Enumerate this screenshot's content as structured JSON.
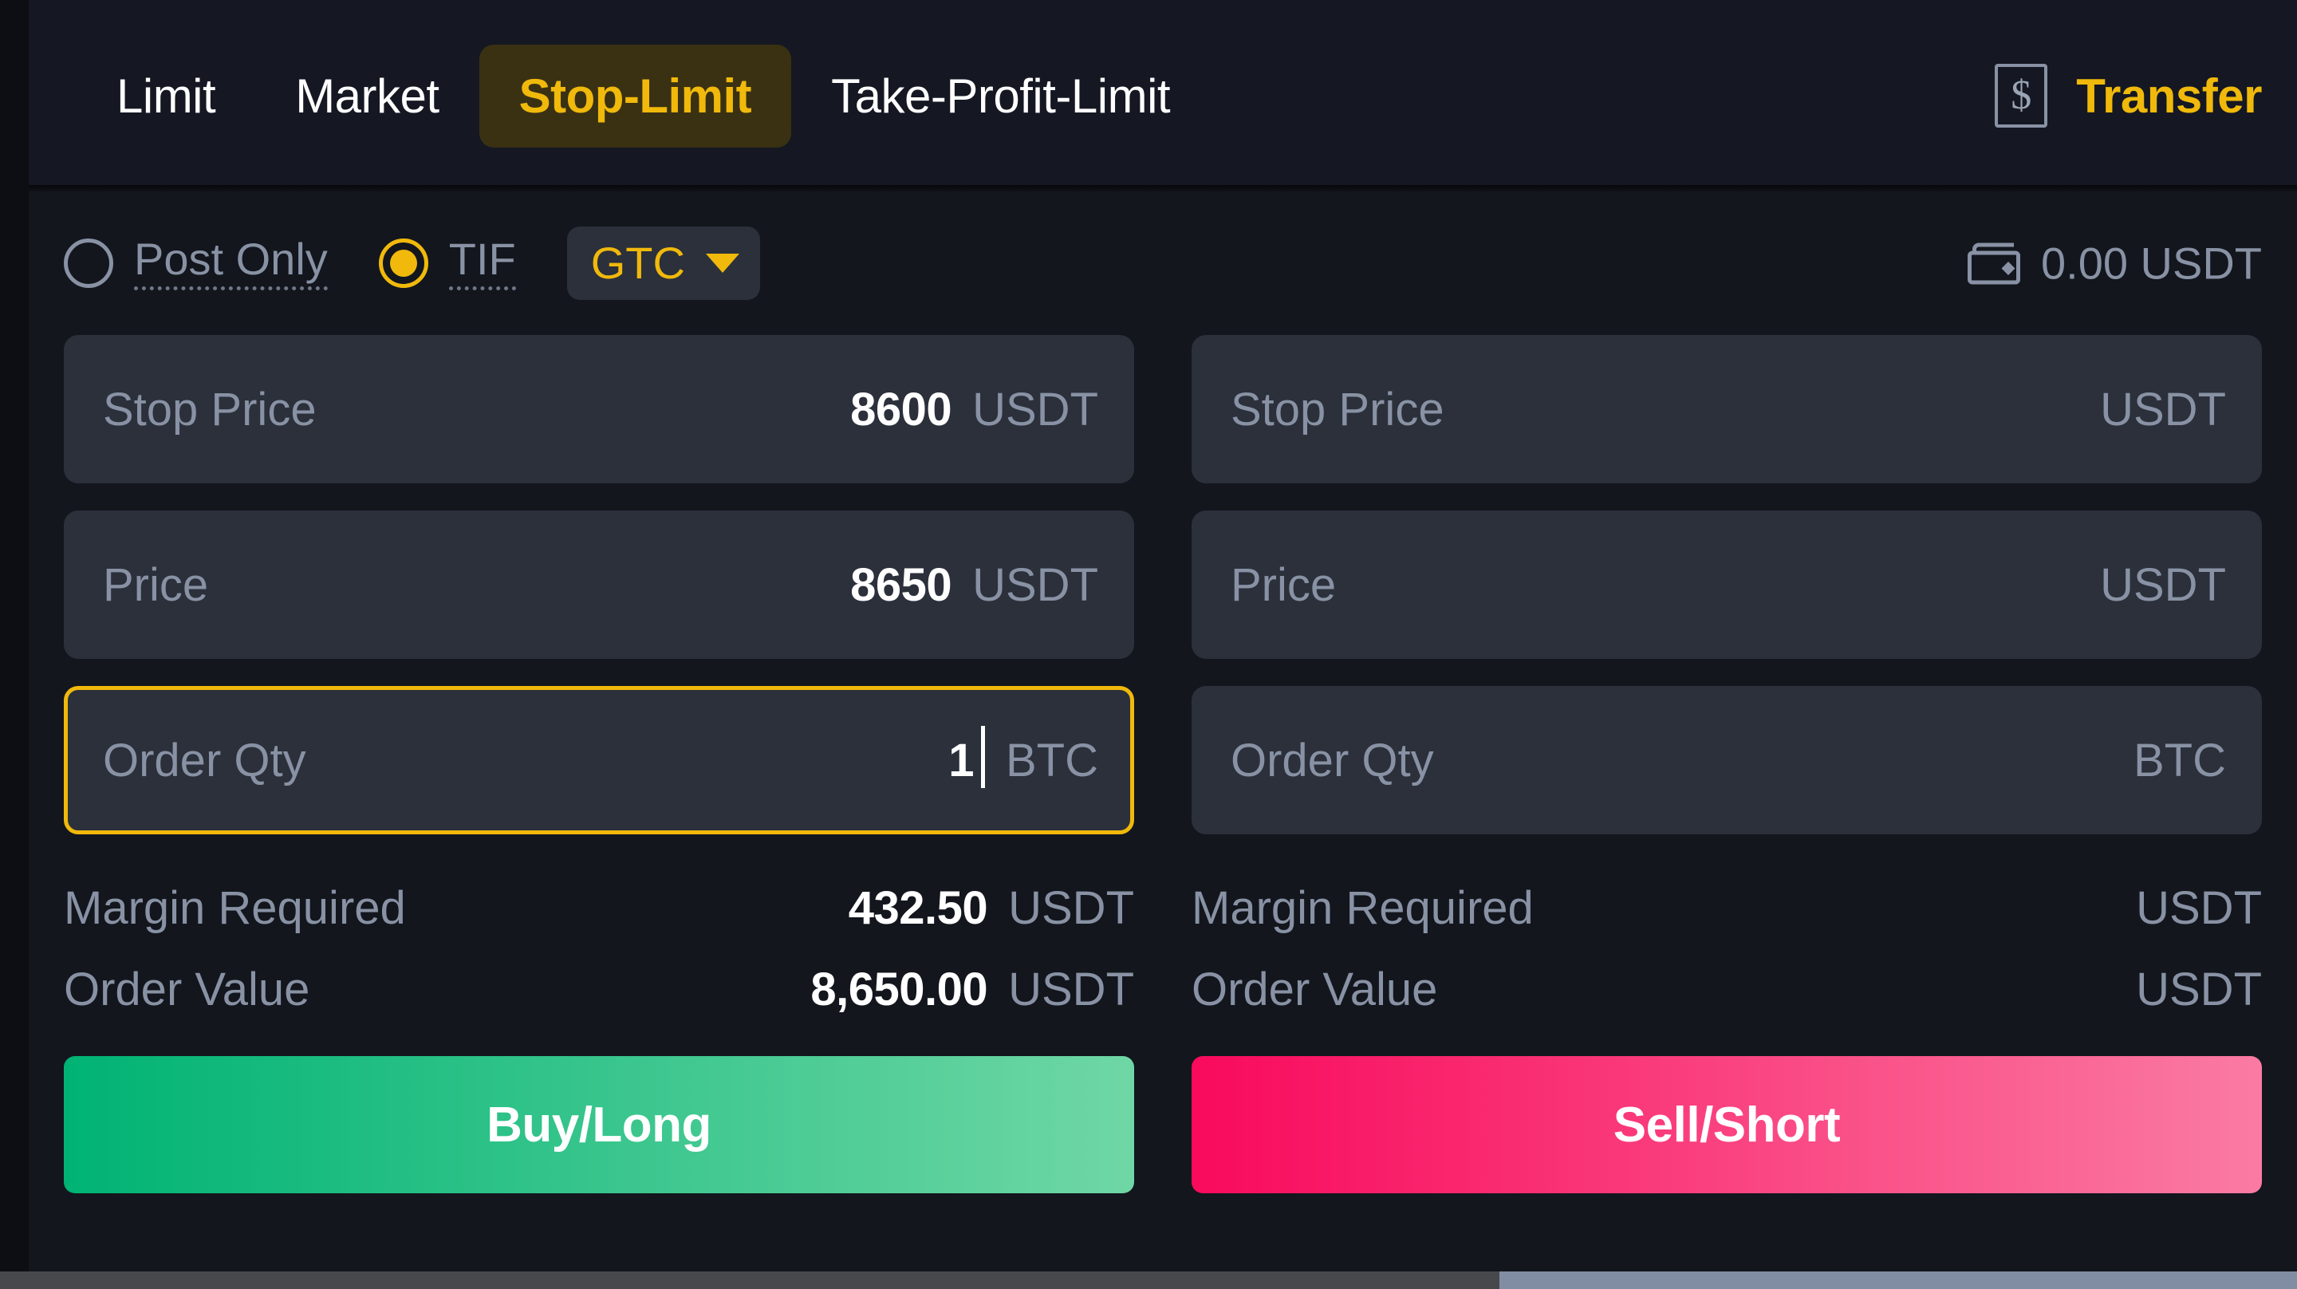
{
  "header": {
    "tabs": [
      {
        "label": "Limit",
        "active": false
      },
      {
        "label": "Market",
        "active": false
      },
      {
        "label": "Stop-Limit",
        "active": true
      },
      {
        "label": "Take-Profit-Limit",
        "active": false
      }
    ],
    "transfer_icon": "dollar-box-icon",
    "transfer_label": "Transfer"
  },
  "options": {
    "post_only": {
      "label": "Post Only",
      "checked": false
    },
    "tif": {
      "label": "TIF",
      "checked": true
    },
    "tif_select": {
      "value": "GTC",
      "caret": "chevron-down-icon"
    },
    "balance": {
      "icon": "wallet-icon",
      "text": "0.00 USDT"
    }
  },
  "buy": {
    "stop_price": {
      "placeholder": "Stop Price",
      "value": "8600",
      "unit": "USDT"
    },
    "price": {
      "placeholder": "Price",
      "value": "8650",
      "unit": "USDT"
    },
    "order_qty": {
      "placeholder": "Order Qty",
      "value": "1",
      "unit": "BTC",
      "focused": true
    },
    "margin_required": {
      "label": "Margin Required",
      "value": "432.50",
      "unit": "USDT"
    },
    "order_value": {
      "label": "Order Value",
      "value": "8,650.00",
      "unit": "USDT"
    },
    "action_label": "Buy/Long"
  },
  "sell": {
    "stop_price": {
      "placeholder": "Stop Price",
      "value": "",
      "unit": "USDT"
    },
    "price": {
      "placeholder": "Price",
      "value": "",
      "unit": "USDT"
    },
    "order_qty": {
      "placeholder": "Order Qty",
      "value": "",
      "unit": "BTC",
      "focused": false
    },
    "margin_required": {
      "label": "Margin Required",
      "value": "",
      "unit": "USDT"
    },
    "order_value": {
      "label": "Order Value",
      "value": "",
      "unit": "USDT"
    },
    "action_label": "Sell/Short"
  },
  "colors": {
    "accent": "#f0b90b",
    "panel_bg": "#13161d",
    "header_bg": "#151822",
    "field_bg": "#2b303b",
    "muted_text": "#8892a4",
    "buy_gradient_start": "#00b374",
    "buy_gradient_end": "#6fd7a5",
    "sell_gradient_start": "#f90a5c",
    "sell_gradient_end": "#fa7ba4"
  }
}
